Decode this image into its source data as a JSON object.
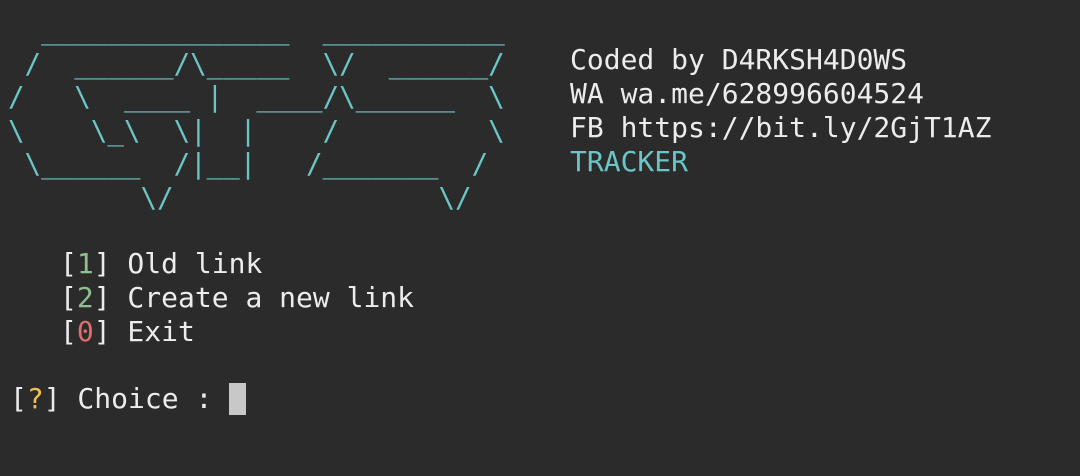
{
  "logo": {
    "ascii_art": "  _______________  ___________\n /  ______/\\_____  \\/  ______/\n/   \\  ____ |  ____/\\______  \\\n\\    \\_\\  \\|  |    /         \\\n \\______  /|__|   /_______  /\n        \\/                \\/",
    "color": "#6cc5c5"
  },
  "info": {
    "coded_by": "Coded by D4RKSH4D0WS",
    "wa": "WA wa.me/628996604524",
    "fb": "FB https://bit.ly/2GjT1AZ",
    "tracker": "TRACKER"
  },
  "menu": {
    "items": [
      {
        "open": "[",
        "key": "1",
        "close": "]",
        "label": " Old link",
        "key_color": "#8fc08f"
      },
      {
        "open": "[",
        "key": "2",
        "close": "]",
        "label": " Create a new link",
        "key_color": "#8fc08f"
      },
      {
        "open": "[",
        "key": "0",
        "close": "]",
        "label": " Exit",
        "key_color": "#e06c6c"
      }
    ]
  },
  "prompt": {
    "open": "[",
    "symbol": "?",
    "close": "]",
    "text": " Choice : "
  },
  "colors": {
    "background": "#2b2b2b",
    "foreground": "#ececec",
    "accent_cyan": "#6cc5c5",
    "green": "#8fc08f",
    "red": "#e06c6c",
    "yellow": "#f0c050"
  }
}
